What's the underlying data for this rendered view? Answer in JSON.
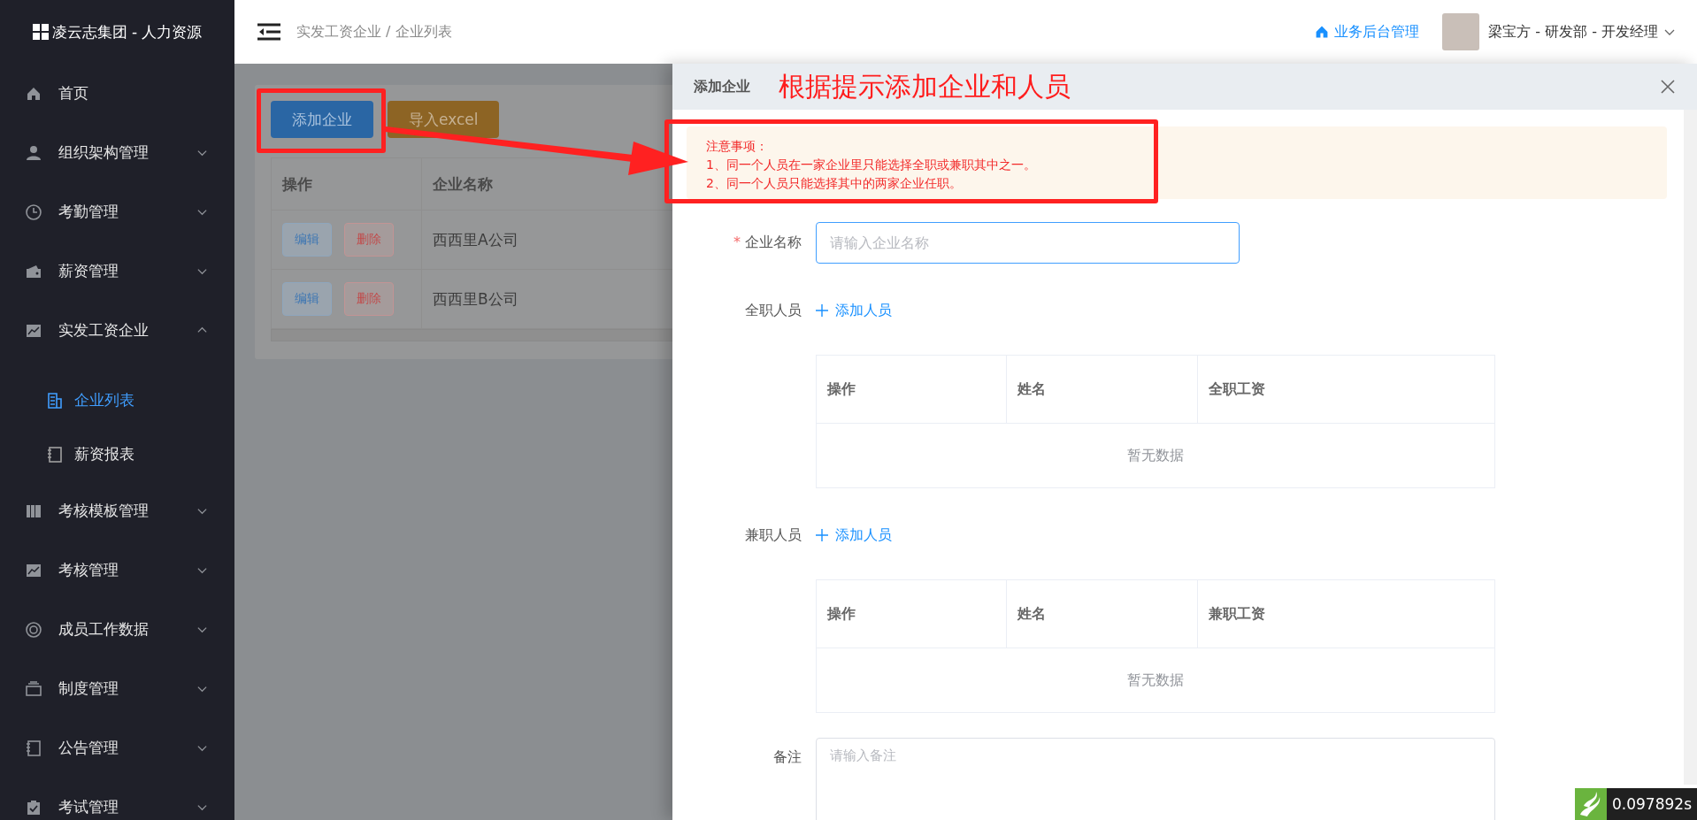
{
  "sidebar": {
    "logo": "凌云志集团 - 人力资源",
    "items": [
      {
        "label": "首页",
        "kind": "link"
      },
      {
        "label": "组织架构管理",
        "kind": "menu",
        "expanded": false
      },
      {
        "label": "考勤管理",
        "kind": "menu",
        "expanded": false
      },
      {
        "label": "薪资管理",
        "kind": "menu",
        "expanded": false
      },
      {
        "label": "实发工资企业",
        "kind": "menu",
        "expanded": true,
        "children": [
          {
            "label": "企业列表",
            "selected": true
          },
          {
            "label": "薪资报表",
            "selected": false
          }
        ]
      },
      {
        "label": "考核模板管理",
        "kind": "menu",
        "expanded": false
      },
      {
        "label": "考核管理",
        "kind": "menu",
        "expanded": false
      },
      {
        "label": "成员工作数据",
        "kind": "menu",
        "expanded": false
      },
      {
        "label": "制度管理",
        "kind": "menu",
        "expanded": false
      },
      {
        "label": "公告管理",
        "kind": "menu",
        "expanded": false
      },
      {
        "label": "考试管理",
        "kind": "menu",
        "expanded": false
      }
    ]
  },
  "header": {
    "breadcrumb": "实发工资企业 / 企业列表",
    "admin_link": "业务后台管理",
    "user": "梁宝方 - 研发部 - 开发经理"
  },
  "page": {
    "buttons": [
      {
        "label": "添加企业",
        "kind": "primary"
      },
      {
        "label": "导入excel",
        "kind": "warning"
      }
    ],
    "table": {
      "columns": [
        "操作",
        "企业名称"
      ],
      "rows": [
        {
          "actions": [
            "编辑",
            "删除"
          ],
          "name": "西西里A公司"
        },
        {
          "actions": [
            "编辑",
            "删除"
          ],
          "name": "西西里B公司"
        }
      ]
    }
  },
  "drawer": {
    "title": "添加企业",
    "annotation": "根据提示添加企业和人员",
    "alert": {
      "title": "注意事项：",
      "lines": [
        "1、同一个人员在一家企业里只能选择全职或兼职其中之一。",
        "2、同一个人员只能选择其中的两家企业任职。"
      ]
    },
    "company": {
      "required_mark": "*",
      "label": "企业名称",
      "placeholder": "请输入企业名称"
    },
    "staff_sections": [
      {
        "label": "全职人员",
        "add_link": "添加人员",
        "columns": [
          "操作",
          "姓名",
          "全职工资"
        ],
        "empty": "暂无数据"
      },
      {
        "label": "兼职人员",
        "add_link": "添加人员",
        "columns": [
          "操作",
          "姓名",
          "兼职工资"
        ],
        "empty": "暂无数据"
      }
    ],
    "remark": {
      "label": "备注",
      "placeholder": "请输入备注"
    }
  },
  "timing_badge": "0.097892s"
}
